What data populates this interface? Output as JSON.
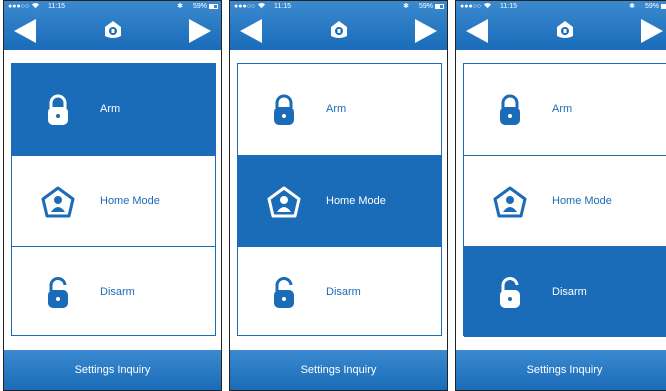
{
  "status": {
    "signal": "●●●○○",
    "time": "11:15",
    "battery": "59%",
    "bluetooth": "✱"
  },
  "options": [
    "Arm",
    "Home Mode",
    "Disarm"
  ],
  "footer": "Settings Inquiry",
  "frames": [
    {
      "selected": 0
    },
    {
      "selected": 1
    },
    {
      "selected": 2
    }
  ],
  "colors": {
    "accent": "#1a6cb8",
    "header": "#3b8ad0",
    "text_on_accent": "#ffffff"
  },
  "icons": {
    "back": "back-arrow-icon",
    "forward": "forward-arrow-icon",
    "logo": "house-shield-logo-icon",
    "arm": "locked-padlock-icon",
    "home": "house-person-icon",
    "disarm": "unlocked-padlock-icon"
  }
}
